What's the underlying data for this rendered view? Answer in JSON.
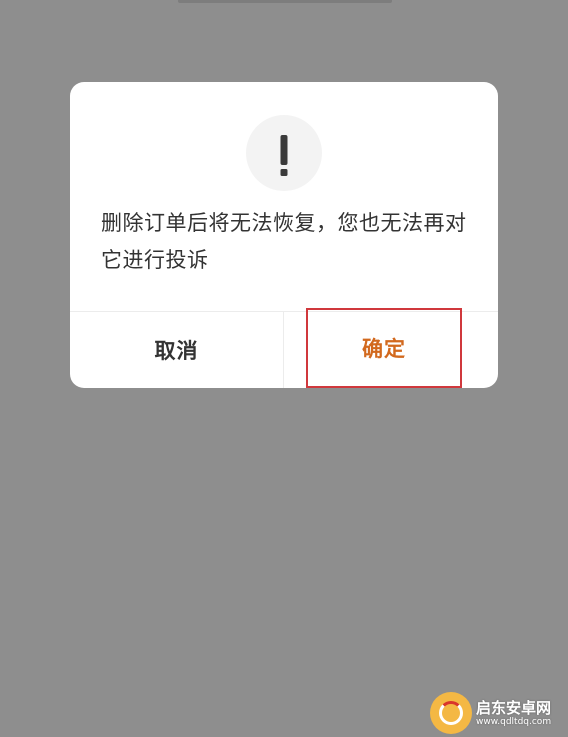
{
  "dialog": {
    "message": "删除订单后将无法恢复，您也无法再对它进行投诉",
    "icon": "exclamation-icon",
    "cancel_label": "取消",
    "confirm_label": "确定"
  },
  "watermark": {
    "title": "启东安卓网",
    "url": "www.qdltdq.com"
  },
  "colors": {
    "overlay": "#8e8e8e",
    "dialog_bg": "#ffffff",
    "icon_bg": "#f3f3f3",
    "icon_fg": "#3a3a3a",
    "text": "#333333",
    "confirm_text": "#d2691e",
    "confirm_outline": "#d0383c",
    "divider": "#ececec"
  }
}
